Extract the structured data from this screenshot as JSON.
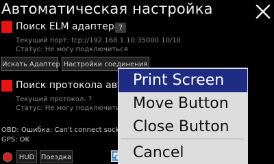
{
  "window": {
    "title": "Автоматическая настройка",
    "close_icon": "close-x-icon"
  },
  "adapter": {
    "title": "Поиск ELM адаптера",
    "help": "?",
    "port_line": "Текущий порт: tcp://192.168.1.10:35000 10/10",
    "status_line": "Статус: Не могу подключиться",
    "search_button": "Искать Адаптер",
    "settings_button": "Настройки соединения",
    "indicator_color": "#ee1111"
  },
  "protocol": {
    "title": "Поиск протокола авто",
    "protocol_line": "Текущий протокол: ?",
    "status_line": "Статус: Не могу подключиться",
    "indicator_color": "#ee1111"
  },
  "status": {
    "obd_line": "OBD: Ошибка: Can't connect socke",
    "gps_line": "GPS: OK"
  },
  "bottom_bar": {
    "record_icon": "record-circle-icon",
    "hud_label": "HUD",
    "trip_label": "Поездка",
    "tray_icon": "screen-window-icon"
  },
  "context_menu": {
    "items": [
      {
        "label": "Print Screen",
        "selected": true
      },
      {
        "label": "Move Button",
        "selected": false
      },
      {
        "label": "Close Button",
        "selected": false
      },
      {
        "label": "Cancel",
        "selected": false
      }
    ],
    "highlight_color": "#1e2c84"
  }
}
